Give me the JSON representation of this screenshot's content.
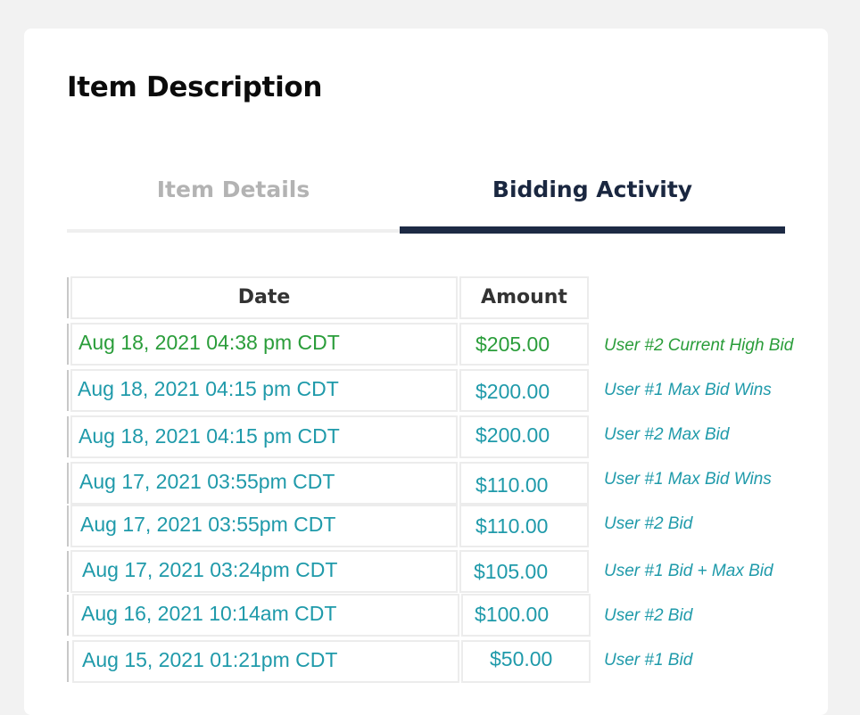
{
  "page_title": "Item Description",
  "tabs": {
    "item_details": "Item Details",
    "bidding_activity": "Bidding Activity",
    "active": "Bidding Activity"
  },
  "table": {
    "headers": {
      "date": "Date",
      "amount": "Amount"
    },
    "rows": [
      {
        "date": "Aug 18, 2021 04:38 pm CDT",
        "amount": "$205.00",
        "note": "User #2 Current High Bid",
        "highlight": "green"
      },
      {
        "date": "Aug 18, 2021 04:15 pm CDT",
        "amount": "$200.00",
        "note": "User #1 Max Bid Wins",
        "highlight": "teal"
      },
      {
        "date": "Aug 18, 2021 04:15 pm CDT",
        "amount": "$200.00",
        "note": "User #2 Max Bid",
        "highlight": "teal"
      },
      {
        "date": "Aug 17, 2021 03:55pm CDT",
        "amount": "$110.00",
        "note": "User #1 Max Bid Wins",
        "highlight": "teal"
      },
      {
        "date": "Aug 17, 2021 03:55pm CDT",
        "amount": "$110.00",
        "note": "User #2 Bid",
        "highlight": "teal"
      },
      {
        "date": "Aug 17, 2021 03:24pm CDT",
        "amount": "$105.00",
        "note": "User #1 Bid + Max Bid",
        "highlight": "teal"
      },
      {
        "date": "Aug 16, 2021 10:14am CDT",
        "amount": "$100.00",
        "note": "User #2 Bid",
        "highlight": "teal"
      },
      {
        "date": "Aug 15, 2021 01:21pm CDT",
        "amount": "$50.00",
        "note": "User #1 Bid",
        "highlight": "teal"
      }
    ]
  },
  "colors": {
    "page_bg": "#f2f2f2",
    "card_bg": "#ffffff",
    "title": "#0b0b0b",
    "tab_inactive": "#b3b3b3",
    "tab_active": "#1a2740",
    "tab_underline": "#1d2a44",
    "high_bid_green": "#2a9d3a",
    "bid_teal": "#1f9aaa"
  }
}
